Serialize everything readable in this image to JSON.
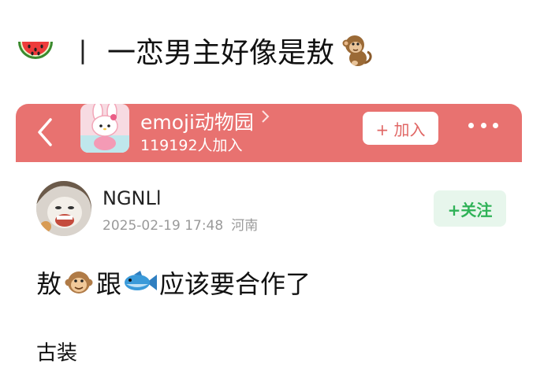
{
  "headline": {
    "separator": "丨",
    "title": "一恋男主好像是敖",
    "leading_icon": "watermelon-icon",
    "trailing_icon": "monkey-icon"
  },
  "group": {
    "name": "emoji动物园",
    "member_count": "119192人加入",
    "join_label": "+ 加入",
    "bar_color": "#e87270"
  },
  "post": {
    "username": "NGNLl",
    "timestamp": "2025-02-19 17:48",
    "location": "河南",
    "follow_label": "+关注",
    "body_part1": "敖",
    "body_part2": "跟",
    "body_part3": "应该要合作了",
    "body_icons": [
      "monkey-face-icon",
      "fish-icon"
    ],
    "tail_text": "古装"
  }
}
